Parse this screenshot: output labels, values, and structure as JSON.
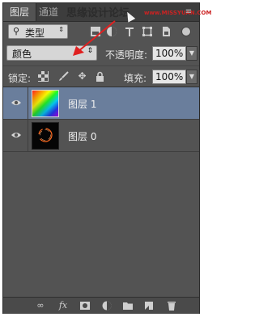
{
  "tabs": {
    "active": "图层",
    "inactive": "通道"
  },
  "watermark": {
    "text": "思缘设计论坛",
    "url": "www.MISSYUAN.COM"
  },
  "filter": {
    "label": "类型"
  },
  "blend_mode": {
    "value": "颜色"
  },
  "opacity": {
    "label": "不透明度:",
    "value": "100%"
  },
  "lock": {
    "label": "锁定:"
  },
  "fill": {
    "label": "填充:",
    "value": "100%"
  },
  "layers": [
    {
      "name": "图层 1",
      "selected": true
    },
    {
      "name": "图层 0",
      "selected": false
    }
  ],
  "bottom_bar": {
    "fx_label": "fx"
  },
  "colors": {
    "panel_bg": "#535353",
    "selected_row": "#6a7e9c",
    "arrow": "#e02020"
  }
}
